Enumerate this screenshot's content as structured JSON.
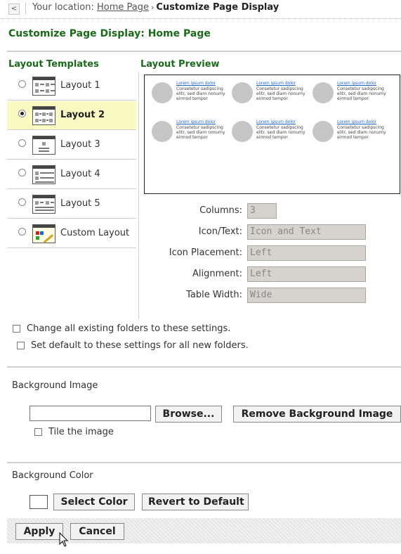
{
  "breadcrumb": {
    "back_glyph": "<",
    "prefix": "Your location: ",
    "home": "Home Page",
    "separator": "›",
    "current": "Customize Page Display"
  },
  "page_title": "Customize Page Display: Home Page",
  "layout_templates": {
    "heading": "Layout Templates",
    "items": [
      {
        "label": "Layout 1",
        "selected": false
      },
      {
        "label": "Layout 2",
        "selected": true
      },
      {
        "label": "Layout 3",
        "selected": false
      },
      {
        "label": "Layout 4",
        "selected": false
      },
      {
        "label": "Layout 5",
        "selected": false
      },
      {
        "label": "Custom Layout",
        "selected": false
      }
    ]
  },
  "preview": {
    "heading": "Layout Preview",
    "item_title": "Lorem ipsum dolor",
    "item_text": "Consetetur sadipscing elitr, sed diam nonumy eirmod tempor"
  },
  "settings": {
    "columns_label": "Columns:",
    "columns_value": "3",
    "icon_text_label": "Icon/Text:",
    "icon_text_value": "Icon and Text",
    "icon_placement_label": "Icon Placement:",
    "icon_placement_value": "Left",
    "alignment_label": "Alignment:",
    "alignment_value": "Left",
    "table_width_label": "Table Width:",
    "table_width_value": "Wide"
  },
  "options": {
    "change_existing": "Change all existing folders to these settings.",
    "set_default": "Set default to these settings for all new folders."
  },
  "background_image": {
    "title": "Background Image",
    "browse": "Browse...",
    "remove": "Remove Background Image",
    "tile": "Tile the image"
  },
  "background_color": {
    "title": "Background Color",
    "select": "Select Color",
    "revert": "Revert to Default"
  },
  "footer": {
    "apply": "Apply",
    "cancel": "Cancel"
  }
}
